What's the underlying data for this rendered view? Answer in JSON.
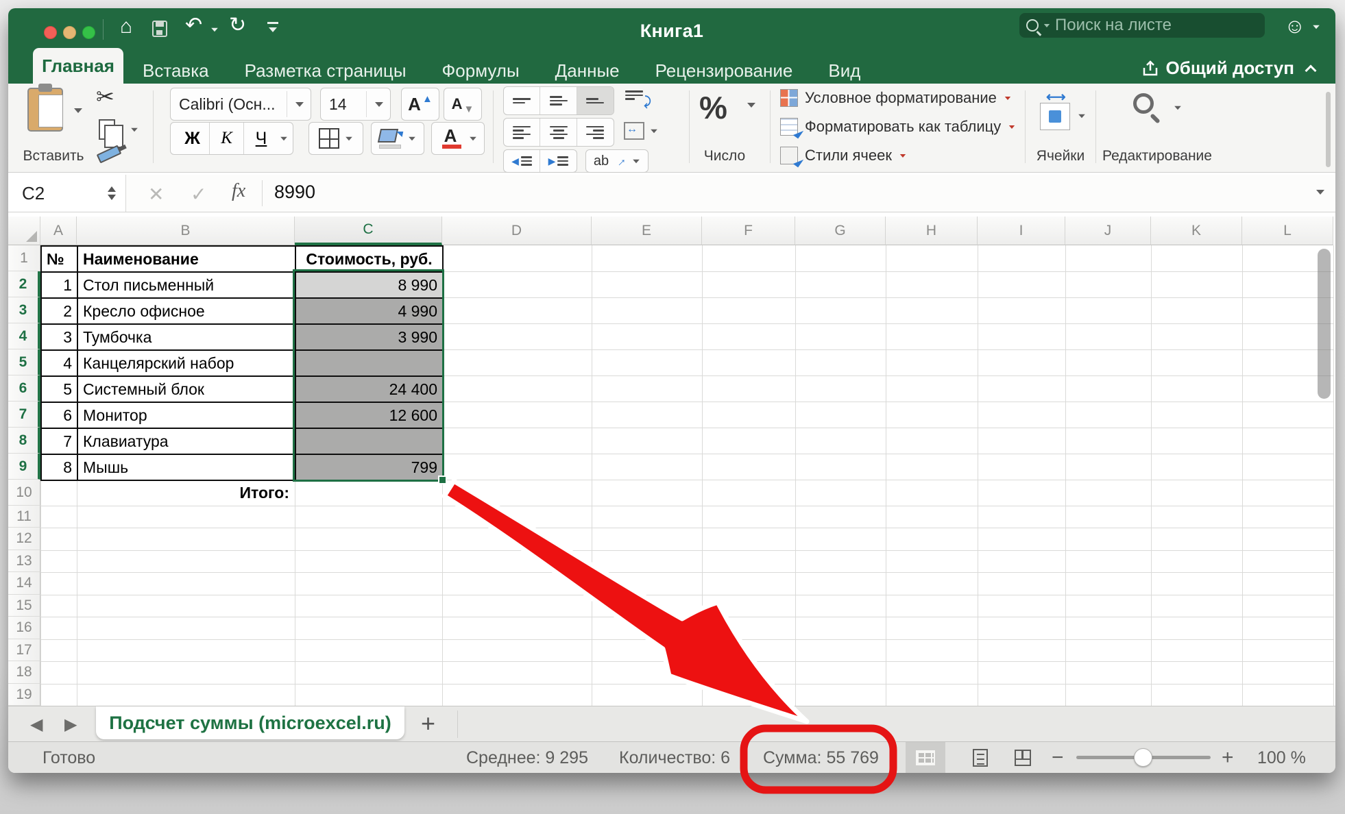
{
  "win": {
    "title": "Книга1"
  },
  "search": {
    "placeholder": "Поиск на листе"
  },
  "tabs": {
    "items": [
      "Главная",
      "Вставка",
      "Разметка страницы",
      "Формулы",
      "Данные",
      "Рецензирование",
      "Вид"
    ],
    "share_label": "Общий доступ"
  },
  "icons": {
    "home": "⌂",
    "undo": "↶",
    "redo": "↻",
    "scissors": "✂",
    "smiley": "☺",
    "cancel": "✕",
    "confirm": "✓",
    "fx": "fx",
    "orientation": "ab",
    "nav_left": "◀",
    "nav_right": "▶",
    "add_sheet": "+",
    "zoom_out": "−",
    "zoom_in": "+"
  },
  "ribbon": {
    "paste_label": "Вставить",
    "font_name": "Calibri (Осн...",
    "font_size": "14",
    "grow_font": "А",
    "shrink_font": "А",
    "bold": "Ж",
    "italic": "К",
    "underline": "Ч",
    "font_color_letter": "А",
    "percent": "%",
    "number_label": "Число",
    "styles": [
      "Условное форматирование",
      "Форматировать как таблицу",
      "Стили ячеек"
    ],
    "cells_label": "Ячейки",
    "editing_label": "Редактирование"
  },
  "formula": {
    "name_box": "C2",
    "value": "8990"
  },
  "sheet": {
    "columns": [
      "A",
      "B",
      "C",
      "D",
      "E",
      "F",
      "G",
      "H",
      "I",
      "J",
      "K",
      "L"
    ],
    "rows_nums": [
      "1",
      "2",
      "3",
      "4",
      "5",
      "6",
      "7",
      "8",
      "9",
      "10",
      "11",
      "12",
      "13",
      "14",
      "15",
      "16",
      "17",
      "18",
      "19"
    ]
  },
  "table": {
    "headers": {
      "num": "№",
      "name": "Наименование",
      "cost": "Стоимость, руб."
    },
    "rows": [
      {
        "n": "1",
        "name": "Стол письменный",
        "value": "8 990"
      },
      {
        "n": "2",
        "name": "Кресло офисное",
        "value": "4 990"
      },
      {
        "n": "3",
        "name": "Тумбочка",
        "value": "3 990"
      },
      {
        "n": "4",
        "name": "Канцелярский набор",
        "value": ""
      },
      {
        "n": "5",
        "name": "Системный блок",
        "value": "24 400"
      },
      {
        "n": "6",
        "name": "Монитор",
        "value": "12 600"
      },
      {
        "n": "7",
        "name": "Клавиатура",
        "value": ""
      },
      {
        "n": "8",
        "name": "Мышь",
        "value": "799"
      }
    ],
    "total_label": "Итого:"
  },
  "sheet_tabs": {
    "active": "Подсчет суммы (microexcel.ru)"
  },
  "status": {
    "mode": "Готово",
    "average": "Среднее: 9 295",
    "count": "Количество: 6",
    "sum": "Сумма: 55 769",
    "zoom": "100 %"
  },
  "colors": {
    "accent_green": "#217346",
    "arrow_red": "#ed1111",
    "circle_red": "#e51414"
  }
}
